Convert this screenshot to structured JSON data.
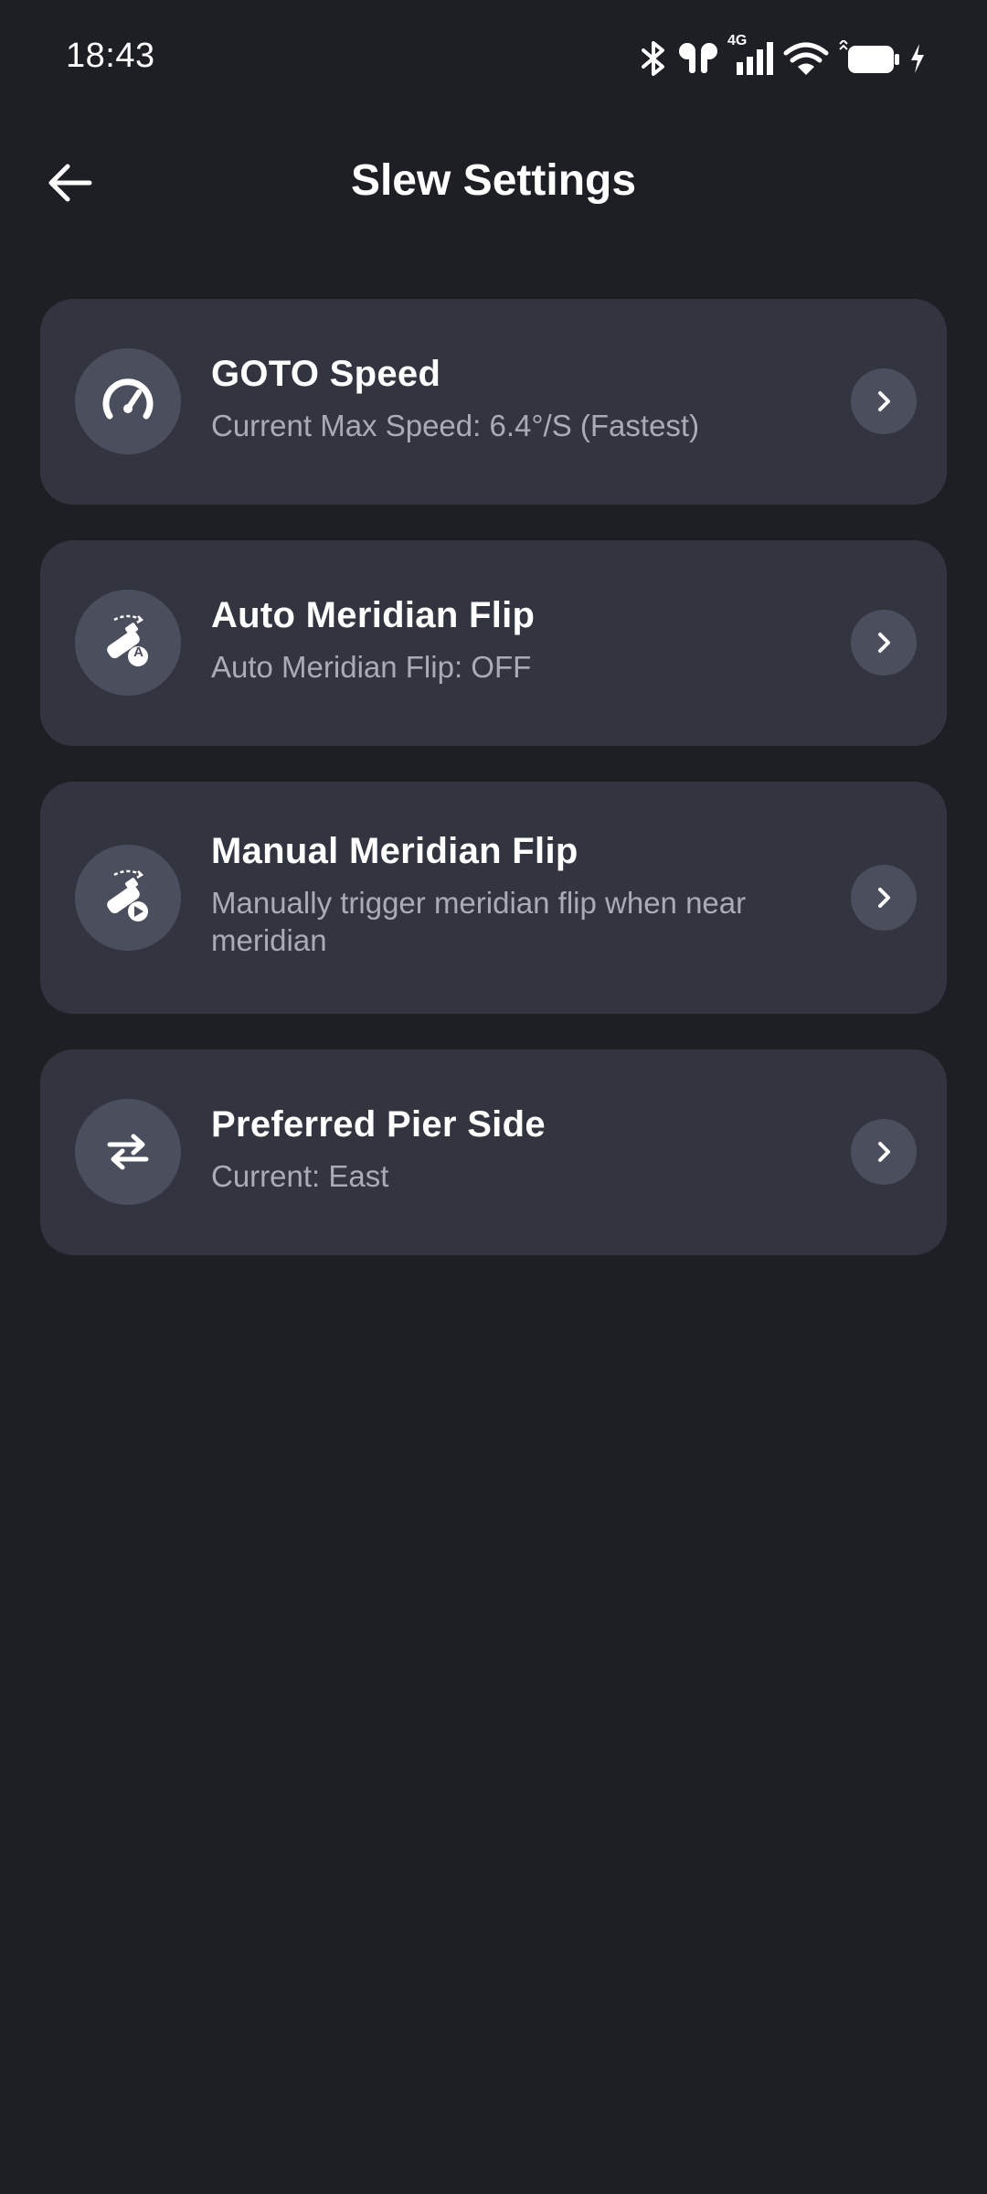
{
  "status_bar": {
    "time": "18:43",
    "network_label": "4G",
    "icons": [
      "bluetooth-icon",
      "earbuds-icon",
      "cellular-signal-icon",
      "wifi-icon",
      "battery-icon",
      "charging-icon"
    ]
  },
  "header": {
    "title": "Slew Settings",
    "back_icon": "arrow-left-icon"
  },
  "colors": {
    "background": "#1e1f24",
    "card": "#32343f",
    "icon_circle": "#4b4f5d",
    "subtitle": "#a9acb6"
  },
  "settings": [
    {
      "title": "GOTO Speed",
      "subtitle": "Current Max Speed: 6.4°/S (Fastest)",
      "icon": "speedometer-icon"
    },
    {
      "title": "Auto Meridian Flip",
      "subtitle": "Auto Meridian Flip: OFF",
      "icon": "telescope-auto-flip-icon",
      "icon_badge": "A"
    },
    {
      "title": "Manual Meridian Flip",
      "subtitle": "Manually trigger meridian flip when near meridian",
      "icon": "telescope-manual-flip-icon"
    },
    {
      "title": "Preferred Pier Side",
      "subtitle": "Current: East",
      "icon": "swap-arrows-icon"
    }
  ]
}
